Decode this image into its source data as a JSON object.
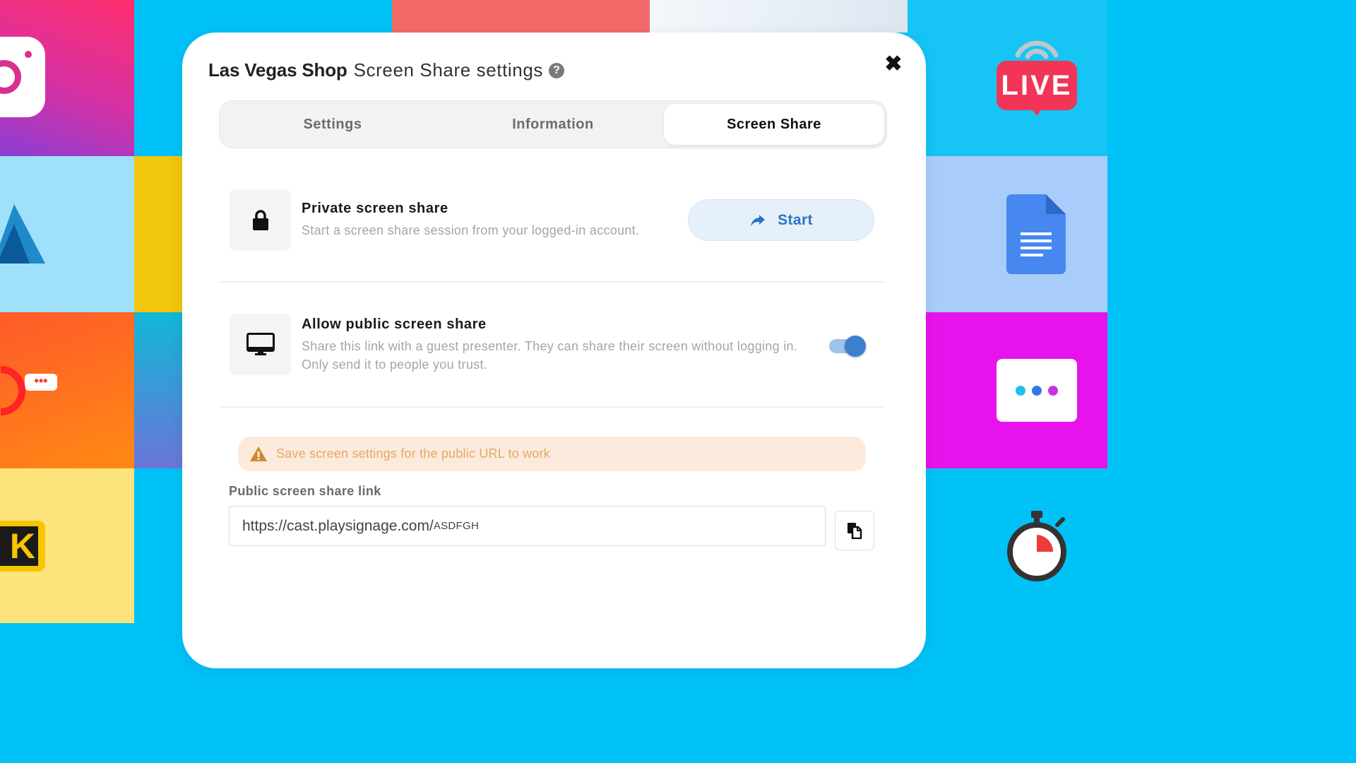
{
  "dialog": {
    "shop_name": "Las Vegas Shop",
    "title_rest": "Screen Share settings",
    "help_icon": "?",
    "close_icon": "✖"
  },
  "tabs": [
    {
      "label": "Settings",
      "active": false
    },
    {
      "label": "Information",
      "active": false
    },
    {
      "label": "Screen Share",
      "active": true
    }
  ],
  "private_share": {
    "title": "Private screen share",
    "description": "Start a screen share session from your logged-in account.",
    "button_label": "Start",
    "icon": "lock-icon"
  },
  "public_share": {
    "title": "Allow public screen share",
    "description_line1": "Share this link with a guest presenter. They can share their screen without logging in.",
    "description_line2": "Only send it to people you trust.",
    "enabled": true,
    "icon": "monitor-icon"
  },
  "warning": {
    "text": "Save screen settings for the public URL to work"
  },
  "public_link": {
    "label": "Public screen share link",
    "url_base": "https://cast.playsignage.com/",
    "url_code": "ASDFGH"
  },
  "background_tiles": {
    "live_badge": "LIVE",
    "k_badge": "K"
  },
  "colors": {
    "accent_blue": "#3d7fcf",
    "button_bg": "#e6f0fb",
    "warning_bg": "#fcebdc",
    "warning_text": "#e4a864"
  }
}
